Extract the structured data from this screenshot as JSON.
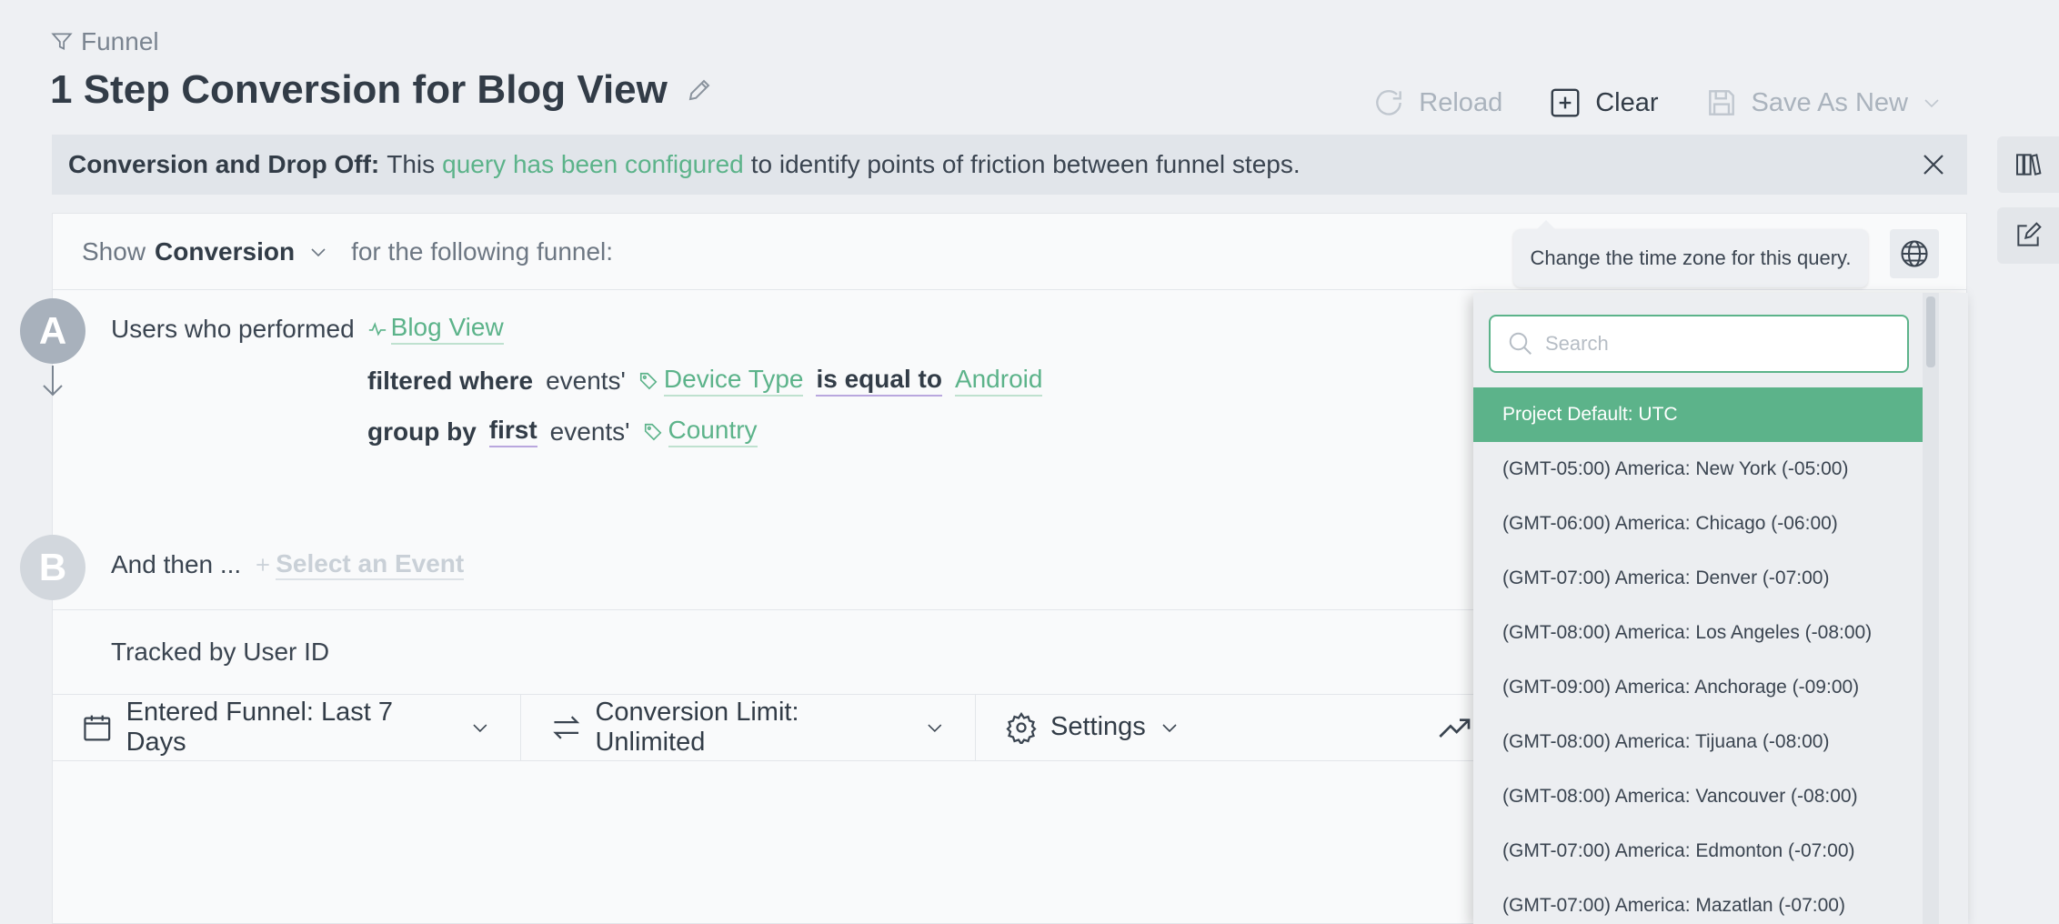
{
  "header": {
    "breadcrumb": "Funnel",
    "title": "1 Step Conversion for Blog View"
  },
  "toolbar": {
    "reload": "Reload",
    "clear": "Clear",
    "save_as_new": "Save As New"
  },
  "banner": {
    "bold": "Conversion and Drop Off:",
    "pre": "This",
    "link": "query has been configured",
    "post": "to identify points of friction between funnel steps."
  },
  "query": {
    "show_label": "Show",
    "metric": "Conversion",
    "suffix": "for the following funnel:"
  },
  "step_a": {
    "badge": "A",
    "performed": "Users who performed",
    "event": "Blog View",
    "filtered_where": "filtered where",
    "events_label": "events'",
    "filter_property": "Device Type",
    "operator": "is equal to",
    "filter_value": "Android",
    "group_by": "group by",
    "group_mode": "first",
    "group_property": "Country"
  },
  "step_b": {
    "badge": "B",
    "and_then": "And then ...",
    "select_event": "Select an Event"
  },
  "tracked_by": "Tracked by User ID",
  "controls": {
    "date_range": "Entered Funnel: Last 7 Days",
    "conversion_limit": "Conversion Limit: Unlimited",
    "settings": "Settings"
  },
  "timezone": {
    "tooltip": "Change the time zone for this query.",
    "search_placeholder": "Search",
    "options": [
      "Project Default: UTC",
      "(GMT-05:00) America: New York (-05:00)",
      "(GMT-06:00) America: Chicago (-06:00)",
      "(GMT-07:00) America: Denver (-07:00)",
      "(GMT-08:00) America: Los Angeles (-08:00)",
      "(GMT-09:00) America: Anchorage (-09:00)",
      "(GMT-08:00) America: Tijuana (-08:00)",
      "(GMT-08:00) America: Vancouver (-08:00)",
      "(GMT-07:00) America: Edmonton (-07:00)",
      "(GMT-07:00) America: Mazatlan (-07:00)"
    ],
    "selected": "Project Default: UTC"
  },
  "colors": {
    "accent": "#5cb38a",
    "badge_a": "#a8b1bc",
    "badge_b": "#d2d7dd"
  }
}
